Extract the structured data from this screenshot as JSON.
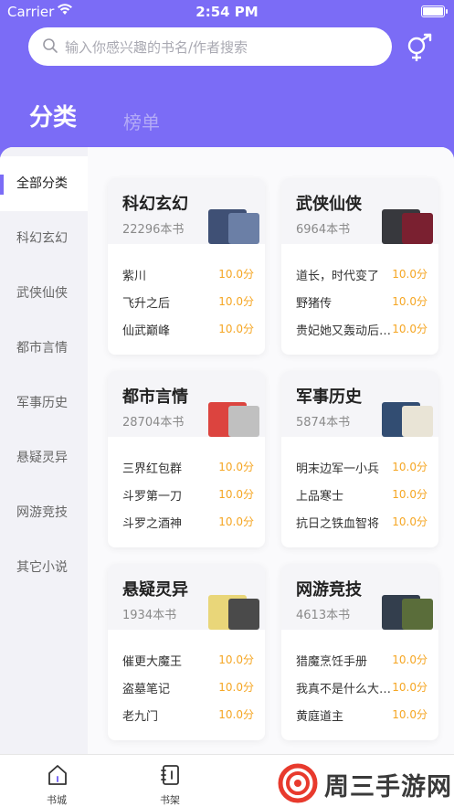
{
  "status_bar": {
    "carrier": "Carrier",
    "time": "2:54 PM"
  },
  "search": {
    "placeholder": "输入你感兴趣的书名/作者搜索"
  },
  "tabs": [
    {
      "label": "分类",
      "active": true
    },
    {
      "label": "榜单",
      "active": false
    }
  ],
  "sidebar": {
    "items": [
      {
        "label": "全部分类",
        "active": true
      },
      {
        "label": "科幻玄幻"
      },
      {
        "label": "武侠仙侠"
      },
      {
        "label": "都市言情"
      },
      {
        "label": "军事历史"
      },
      {
        "label": "悬疑灵异"
      },
      {
        "label": "网游竞技"
      },
      {
        "label": "其它小说"
      }
    ]
  },
  "categories": [
    {
      "title": "科幻玄幻",
      "count": "22296本书",
      "cover_colors": [
        "#2b3e66",
        "#6b7fa6"
      ],
      "books": [
        {
          "name": "紫川",
          "score": "10.0分"
        },
        {
          "name": "飞升之后",
          "score": "10.0分"
        },
        {
          "name": "仙武巅峰",
          "score": "10.0分"
        }
      ]
    },
    {
      "title": "武侠仙侠",
      "count": "6964本书",
      "cover_colors": [
        "#222428",
        "#7a2030"
      ],
      "books": [
        {
          "name": "道长，时代变了",
          "score": "10.0分"
        },
        {
          "name": "野猪传",
          "score": "10.0分"
        },
        {
          "name": "贵妃她又轰动后宫了",
          "score": "10.0分"
        }
      ]
    },
    {
      "title": "都市言情",
      "count": "28704本书",
      "cover_colors": [
        "#d9312a",
        "#c0c0c0"
      ],
      "books": [
        {
          "name": "三界红包群",
          "score": "10.0分"
        },
        {
          "name": "斗罗第一刀",
          "score": "10.0分"
        },
        {
          "name": "斗罗之酒神",
          "score": "10.0分"
        }
      ]
    },
    {
      "title": "军事历史",
      "count": "5874本书",
      "cover_colors": [
        "#1d3b63",
        "#e9e4d6"
      ],
      "books": [
        {
          "name": "明末边军一小兵",
          "score": "10.0分"
        },
        {
          "name": "上品寒士",
          "score": "10.0分"
        },
        {
          "name": "抗日之铁血智将",
          "score": "10.0分"
        }
      ]
    },
    {
      "title": "悬疑灵异",
      "count": "1934本书",
      "cover_colors": [
        "#e8d36a",
        "#4a4a4a"
      ],
      "books": [
        {
          "name": "催更大魔王",
          "score": "10.0分"
        },
        {
          "name": "盗墓笔记",
          "score": "10.0分"
        },
        {
          "name": "老九门",
          "score": "10.0分"
        }
      ]
    },
    {
      "title": "网游竞技",
      "count": "4613本书",
      "cover_colors": [
        "#1e2a3a",
        "#5a6d3a"
      ],
      "books": [
        {
          "name": "猎魔烹饪手册",
          "score": "10.0分"
        },
        {
          "name": "我真不是什么大魔王",
          "score": "10.0分"
        },
        {
          "name": "黄庭道主",
          "score": "10.0分"
        }
      ]
    }
  ],
  "bottom_nav": [
    {
      "label": "书城",
      "icon": "home-icon"
    },
    {
      "label": "书架",
      "icon": "bookshelf-icon"
    }
  ],
  "watermark": {
    "text": "周三手游网"
  },
  "colors": {
    "accent": "#7b6cf6",
    "score": "#f5a623"
  }
}
